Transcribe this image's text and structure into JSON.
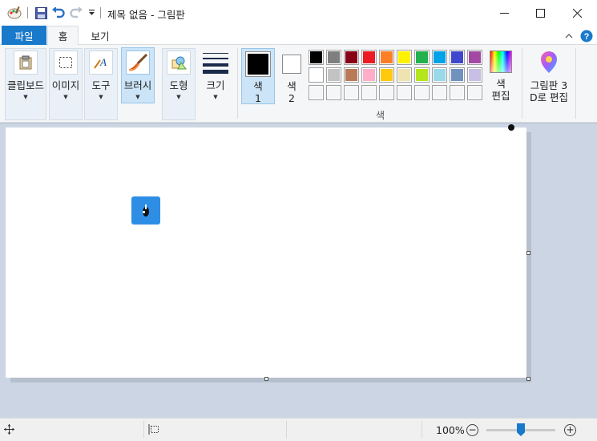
{
  "window": {
    "title": "제목 없음 - 그림판",
    "minimize_glyph": "─",
    "maximize_glyph": "☐",
    "close_glyph": "✕"
  },
  "tabs": {
    "file": "파일",
    "home": "홈",
    "view": "보기"
  },
  "ribbon": {
    "clipboard": "클립보드",
    "image": "이미지",
    "tools": "도구",
    "brushes": "브러시",
    "shapes": "도형",
    "size": "크기",
    "color1_line1": "색",
    "color1_line2": "1",
    "color2_line1": "색",
    "color2_line2": "2",
    "edit_colors_line1": "색",
    "edit_colors_line2": "편집",
    "paint3d_line1": "그림판 3",
    "paint3d_line2": "D로 편집",
    "colors_caption": "색",
    "dropdown_arrow": "▼"
  },
  "colors": {
    "color1": "#000000",
    "color2": "#ffffff",
    "accent": "#1979ca",
    "palette": [
      "#000000",
      "#7f7f7f",
      "#880015",
      "#ed1c24",
      "#ff7f27",
      "#fff200",
      "#22b14c",
      "#00a2e8",
      "#3f48cc",
      "#a349a4",
      "#ffffff",
      "#c3c3c3",
      "#b97a57",
      "#ffaec9",
      "#ffc90e",
      "#efe4b0",
      "#b5e61d",
      "#99d9ea",
      "#7092be",
      "#c8bfe7",
      "",
      "",
      "",
      "",
      "",
      "",
      "",
      "",
      "",
      ""
    ]
  },
  "statusbar": {
    "zoom": "100%",
    "zoom_level": 0.5,
    "zoom_minus": "−",
    "zoom_plus": "+"
  },
  "icons": {
    "app": "paint-palette-icon",
    "save": "save-icon",
    "undo": "undo-icon",
    "redo": "redo-icon",
    "customize": "customize-quick-access-icon",
    "collapse": "chevron-up-icon",
    "help": "help-icon",
    "cursor_position": "cursor-position-icon",
    "selection_size": "selection-size-icon"
  }
}
